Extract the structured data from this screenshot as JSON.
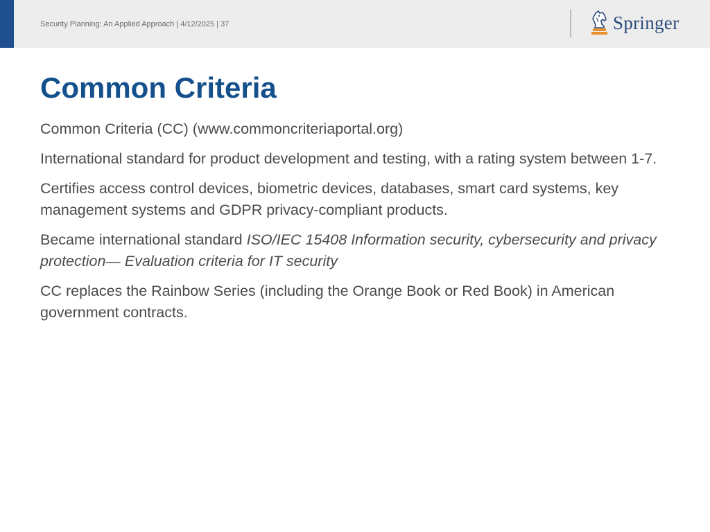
{
  "header": {
    "course_info": "Security Planning: An Applied Approach | 4/12/2025 | 37",
    "publisher": "Springer"
  },
  "slide": {
    "title": "Common Criteria",
    "paragraphs": {
      "p1": "Common Criteria (CC) (www.commoncriteriaportal.org)",
      "p2": "International standard for product development and testing, with a rating system between 1-7.",
      "p3": "Certifies access control devices, biometric devices, databases, smart card systems, key management systems and GDPR privacy-compliant products.",
      "p4_prefix": "Became international standard ",
      "p4_italic": "ISO/IEC 15408 Information security, cybersecurity and privacy protection— Evaluation criteria for IT security",
      "p5": "CC replaces the Rainbow Series (including the Orange Book or Red Book) in American government contracts."
    }
  },
  "colors": {
    "accent": "#1f4f8f",
    "title": "#14508c",
    "body_text": "#4a4a4a",
    "header_bg": "#ededed"
  },
  "icons": {
    "logo": "springer-chess-knight-icon"
  }
}
